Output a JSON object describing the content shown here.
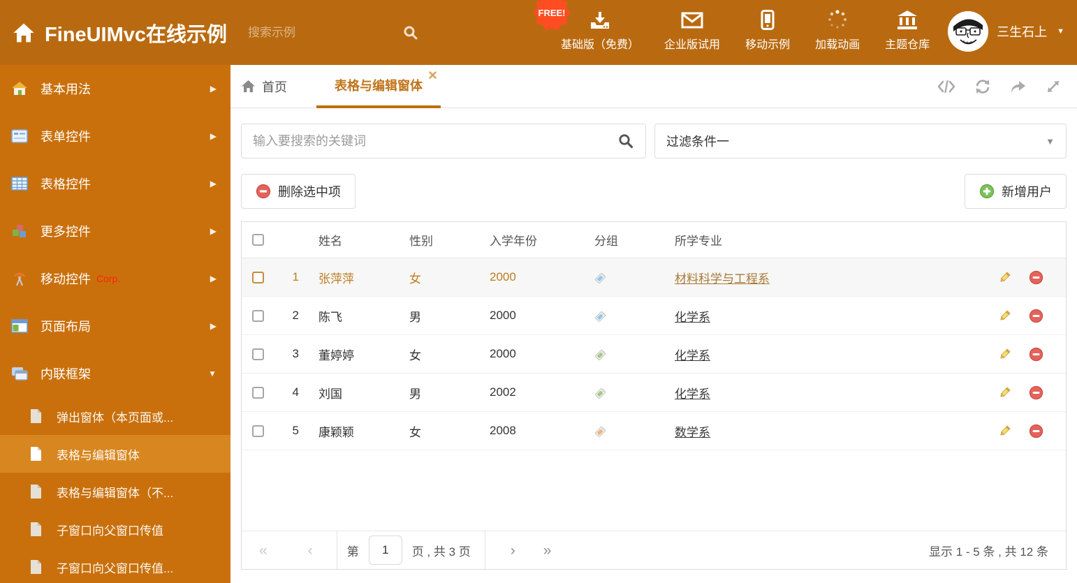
{
  "colors": {
    "header_bg": "#B96A10",
    "sidebar_bg": "#C9700C",
    "sidebar_active_bg": "#D8861F",
    "accent": "#BF6E0A",
    "free_badge_bg": "#FF4D21",
    "hot_row_text": "#BE7D20",
    "tag_blue": "#8EC9F0",
    "tag_green": "#A3C97C",
    "tag_orange": "#F5B172"
  },
  "header": {
    "title": "FineUIMvc在线示例",
    "search_placeholder": "搜索示例",
    "free_badge": "FREE!",
    "nav": [
      {
        "label": "基础版（免费）"
      },
      {
        "label": "企业版试用"
      },
      {
        "label": "移动示例"
      },
      {
        "label": "加载动画"
      },
      {
        "label": "主题仓库"
      }
    ],
    "user_name": "三生石上"
  },
  "sidebar": {
    "items": [
      {
        "label": "基本用法"
      },
      {
        "label": "表单控件"
      },
      {
        "label": "表格控件"
      },
      {
        "label": "更多控件"
      },
      {
        "label": "移动控件",
        "badge": "Corp."
      },
      {
        "label": "页面布局"
      },
      {
        "label": "内联框架"
      }
    ],
    "submenu": [
      {
        "label": "弹出窗体（本页面或..."
      },
      {
        "label": "表格与编辑窗体"
      },
      {
        "label": "表格与编辑窗体（不..."
      },
      {
        "label": "子窗口向父窗口传值"
      },
      {
        "label": "子窗口向父窗口传值..."
      }
    ]
  },
  "tabs": {
    "home": "首页",
    "active": "表格与编辑窗体"
  },
  "filters": {
    "search_placeholder": "输入要搜索的关键词",
    "filter_value": "过滤条件一"
  },
  "grid": {
    "delete_label": "删除选中项",
    "add_label": "新增用户",
    "columns": {
      "name": "姓名",
      "gender": "性别",
      "year": "入学年份",
      "group": "分组",
      "major": "所学专业"
    },
    "rows": [
      {
        "num": "1",
        "name": "张萍萍",
        "gender": "女",
        "year": "2000",
        "tag_color": "#8EC9F0",
        "major": "材料科学与工程系"
      },
      {
        "num": "2",
        "name": "陈飞",
        "gender": "男",
        "year": "2000",
        "tag_color": "#8EC9F0",
        "major": "化学系"
      },
      {
        "num": "3",
        "name": "董婷婷",
        "gender": "女",
        "year": "2000",
        "tag_color": "#A3C97C",
        "major": "化学系"
      },
      {
        "num": "4",
        "name": "刘国",
        "gender": "男",
        "year": "2002",
        "tag_color": "#A3C97C",
        "major": "化学系"
      },
      {
        "num": "5",
        "name": "康颖颖",
        "gender": "女",
        "year": "2008",
        "tag_color": "#F5B172",
        "major": "数学系"
      }
    ]
  },
  "pager": {
    "first": "«",
    "prev": "‹",
    "next": "›",
    "last": "»",
    "page_prefix": "第",
    "page_value": "1",
    "page_suffix": "页 , 共 3 页",
    "summary": "显示 1 - 5 条 , 共 12 条"
  },
  "sidebar_glyphs": {
    "expand": "▶",
    "collapse": "▼"
  }
}
